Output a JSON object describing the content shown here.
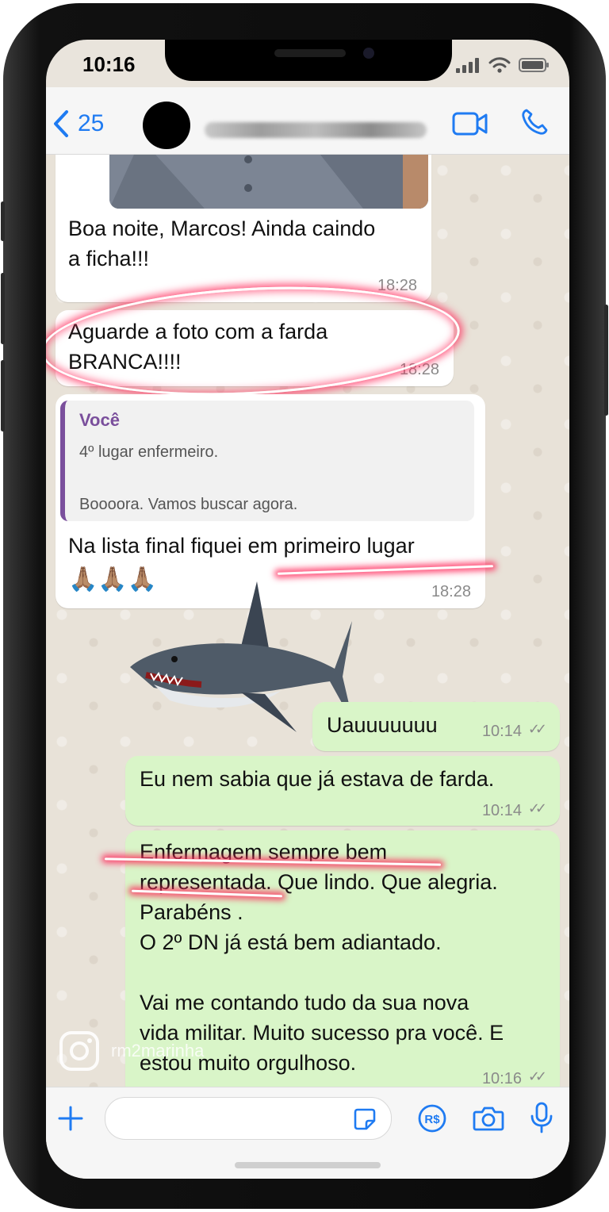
{
  "status_bar": {
    "time": "10:16"
  },
  "header": {
    "back_count": "25"
  },
  "messages": [
    {
      "text": "Boa noite, Marcos! Ainda caindo\na ficha!!!",
      "time": "18:28"
    },
    {
      "text": "Aguarde a foto com a farda\nBRANCA!!!!",
      "time": "18:28"
    },
    {
      "quote": {
        "author": "Você",
        "line1": "4º lugar enfermeiro.",
        "line2": "Boooora. Vamos buscar agora."
      },
      "text": "Na lista final fiquei em primeiro lugar",
      "emojis": "🙏🏽🙏🏽🙏🏽",
      "time": "18:28"
    },
    {
      "text": "Uauuuuuuu",
      "time": "10:14"
    },
    {
      "text": "Eu nem sabia que já estava de farda.",
      "time": "10:14"
    },
    {
      "text": "Enfermagem sempre bem\nrepresentada. Que lindo. Que alegria.\nParabéns .\nO 2º DN já está bem adiantado.\n\nVai me contando tudo da sua nova\nvida militar. Muito sucesso pra você. E\nestou muito orgulhoso.",
      "time": "10:16"
    }
  ],
  "watermark": {
    "handle": "rm2marinha"
  },
  "composer": {
    "placeholder": ""
  },
  "colors": {
    "accent": "#1f7bf2",
    "outgoing": "#d9f5c8",
    "incoming": "#ffffff",
    "highlight": "#ff285a"
  },
  "icons": [
    "back-chevron-icon",
    "video-call-icon",
    "phone-call-icon",
    "add-icon",
    "sticker-icon",
    "payment-icon",
    "camera-icon",
    "microphone-icon",
    "instagram-icon",
    "shark-sticker"
  ]
}
